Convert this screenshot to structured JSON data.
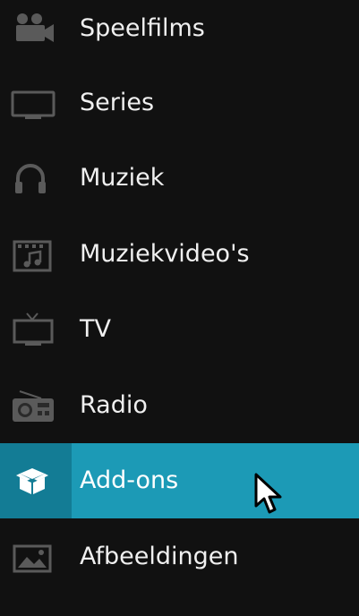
{
  "menu": {
    "items": [
      {
        "label": "Speelfilms",
        "icon": "movie-camera-icon"
      },
      {
        "label": "Series",
        "icon": "monitor-icon"
      },
      {
        "label": "Muziek",
        "icon": "headphones-icon"
      },
      {
        "label": "Muziekvideo's",
        "icon": "music-video-icon"
      },
      {
        "label": "TV",
        "icon": "tv-icon"
      },
      {
        "label": "Radio",
        "icon": "radio-icon"
      },
      {
        "label": "Add-ons",
        "icon": "box-icon",
        "active": true
      },
      {
        "label": "Afbeeldingen",
        "icon": "picture-icon"
      }
    ]
  },
  "colors": {
    "background": "#111111",
    "highlight": "#1c9ab6",
    "highlight_icon_bg": "#137c95",
    "text": "#f0f0f0",
    "icon": "#5a5a5a"
  }
}
